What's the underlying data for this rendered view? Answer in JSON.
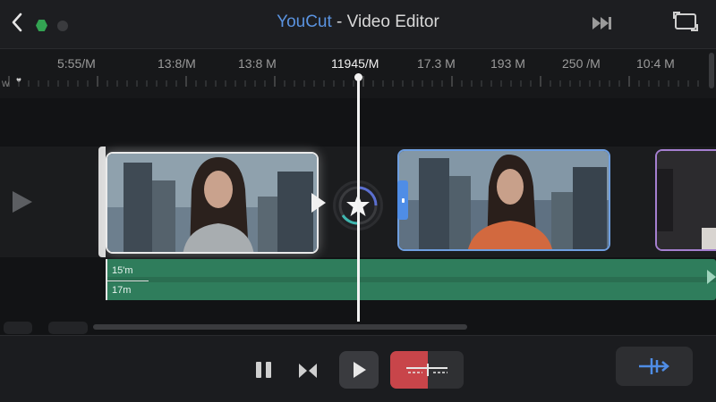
{
  "header": {
    "title_brand": "YouCut",
    "title_rest": " - Video Editor",
    "icons": [
      "back-icon",
      "hex-status-icon",
      "record-dot-icon",
      "skip-forward-icon",
      "fullscreen-icon"
    ]
  },
  "ruler": {
    "marker_w": "W",
    "labels": [
      "5:55/M",
      "13:8/M",
      "13:8 M",
      "11945/M",
      "17.3 M",
      "193 M",
      "250 /M",
      "10:4 M"
    ],
    "current_label": "11945/M"
  },
  "timeline": {
    "clips": [
      {
        "name": "clip-1",
        "selected": true
      },
      {
        "name": "clip-2",
        "selected": false
      },
      {
        "name": "clip-3",
        "selected": false
      }
    ],
    "audio": {
      "top_label": "15'm",
      "bottom_label": "17m"
    }
  },
  "controls": {
    "icons": [
      "pause-icon",
      "split-icon",
      "play-icon",
      "trim-icon",
      "add-keyframe-icon"
    ]
  },
  "colors": {
    "brand": "#5a93e0",
    "selected_border": "#eaeaea",
    "clip2_border": "#6f9fe0",
    "clip3_border": "#a57fd0",
    "audio_track": "#2f7d5c",
    "trim_red": "#c8454a",
    "add_blue": "#4f8de6"
  }
}
